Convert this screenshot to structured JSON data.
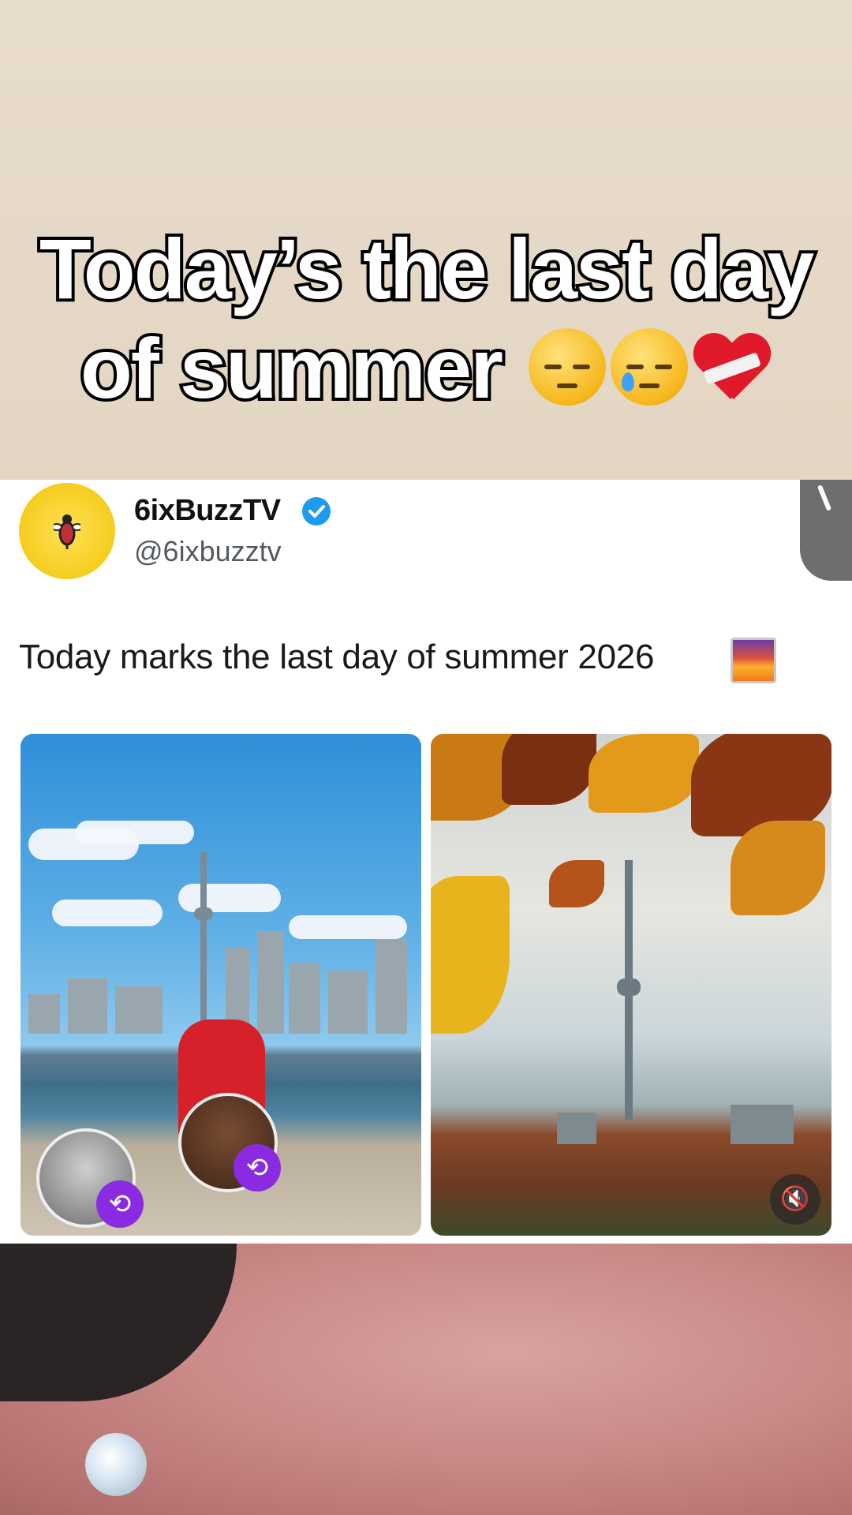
{
  "caption": {
    "line1": "Today’s the last day",
    "line2": "of summer",
    "emojis": [
      "pensive-face-icon",
      "face-holding-back-tears-icon",
      "mending-heart-icon"
    ]
  },
  "tweet": {
    "display_name": "6ixBuzzTV",
    "handle": "@6ixbuzztv",
    "verified_icon": "verified-badge-icon",
    "text": "Today marks the last day of summer 2026",
    "text_emoji": "sunrise-icon",
    "media": [
      {
        "name": "toronto-summer-photo"
      },
      {
        "name": "toronto-autumn-photo",
        "control_icon": "mute-icon"
      }
    ],
    "repost_icon": "repost-icon"
  },
  "colors": {
    "caption_fill": "#ffffff",
    "caption_stroke": "#000000",
    "verified": "#1d9bf0",
    "repost_badge": "#8a2be2",
    "avatar_bg": "#f5cd1f"
  }
}
